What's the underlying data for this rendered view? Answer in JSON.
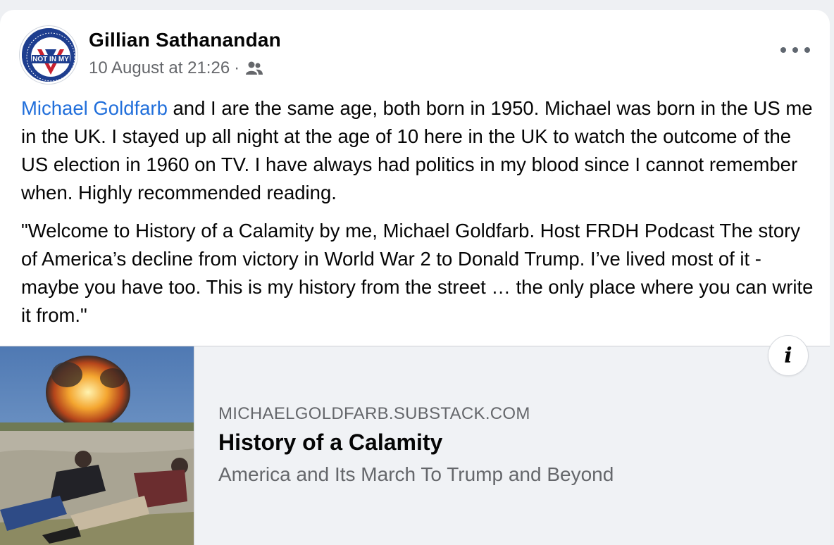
{
  "post": {
    "author": "Gillian Sathanandan",
    "timestamp": "10 August at 21:26",
    "separator": "·",
    "audience_icon": "friends-icon",
    "avatar": {
      "ring_text_top": "DISINFORMATION IS DEADLY",
      "center_text": "NOT IN MY",
      "ring_text_bottom": "VACCINES SAVE LIVES"
    },
    "body": {
      "mention": "Michael Goldfarb",
      "paragraph1_rest": " and I are the same age, both born in 1950. Michael was born in the US me in the UK. I stayed up all night at the age of 10 here in the UK to watch the outcome of the US election in 1960 on TV. I have always had politics in my blood since I cannot remember when. Highly recommended reading.",
      "paragraph2": "\"Welcome to History of a Calamity by me, Michael Goldfarb. Host FRDH Podcast The story of America’s decline from victory in World War 2 to Donald Trump. I’ve lived most of it - maybe you have too. This is my history from the street … the only place where you can write it from.\""
    },
    "link_preview": {
      "domain": "MICHAELGOLDFARB.SUBSTACK.COM",
      "title": "History of a Calamity",
      "subtitle": "America and Its March To Trump and Beyond",
      "info_label": "i"
    }
  },
  "colors": {
    "link": "#216fdb",
    "secondary_text": "#65676b",
    "preview_bg": "#f0f2f5"
  }
}
